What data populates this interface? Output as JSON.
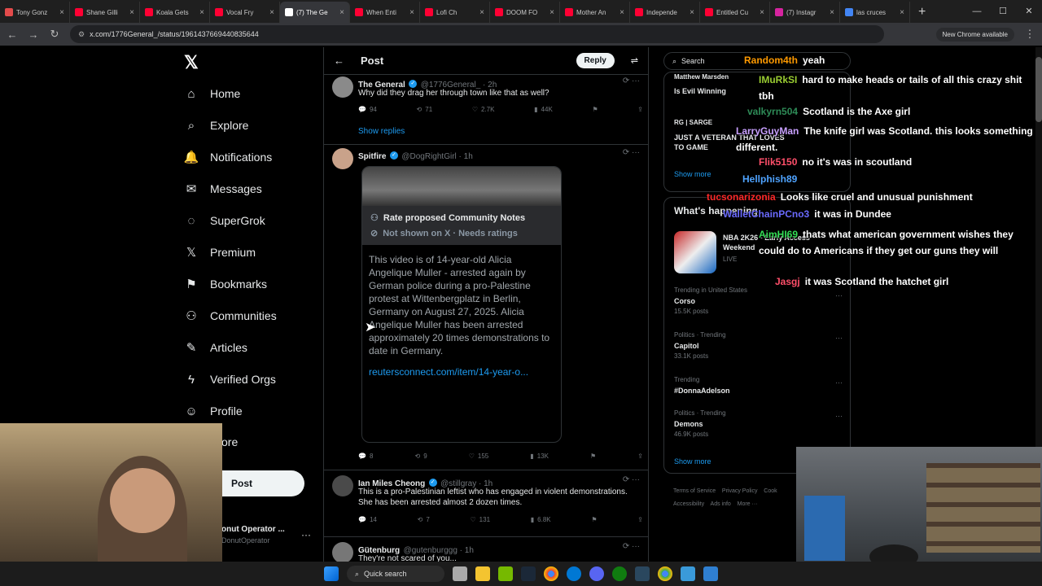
{
  "browser": {
    "tabs": [
      {
        "title": "Tony Gonz",
        "color": "#e34b4b"
      },
      {
        "title": "Shane Gilli",
        "color": "#ff0033"
      },
      {
        "title": "Koala Gets",
        "color": "#ff0033"
      },
      {
        "title": "Vocal Fry",
        "color": "#ff0033"
      },
      {
        "title": "(7) The Ge",
        "color": "#ffffff"
      },
      {
        "title": "When Enti",
        "color": "#ff0033"
      },
      {
        "title": "Lofi Ch",
        "color": "#ff0033"
      },
      {
        "title": "DOOM FO",
        "color": "#ff0033"
      },
      {
        "title": "Mother An",
        "color": "#ff0033"
      },
      {
        "title": "Independe",
        "color": "#ff0033"
      },
      {
        "title": "Entitled Cu",
        "color": "#ff0033"
      },
      {
        "title": "(7) Instagr",
        "color": "#d6249f"
      },
      {
        "title": "las cruces",
        "color": "#4285f4"
      }
    ],
    "active_tab_index": 4,
    "url": "x.com/1776General_/status/1961437669440835644",
    "chrome_available": "New Chrome available"
  },
  "nav": {
    "items": [
      {
        "label": "Home",
        "icon": "home-icon",
        "glyph": "⌂"
      },
      {
        "label": "Explore",
        "icon": "search-icon",
        "glyph": "⌕"
      },
      {
        "label": "Notifications",
        "icon": "bell-icon",
        "glyph": "🔔"
      },
      {
        "label": "Messages",
        "icon": "mail-icon",
        "glyph": "✉"
      },
      {
        "label": "SuperGrok",
        "icon": "grok-icon",
        "glyph": "◌"
      },
      {
        "label": "Premium",
        "icon": "x-icon",
        "glyph": "𝕏"
      },
      {
        "label": "Bookmarks",
        "icon": "bookmark-icon",
        "glyph": "⚑"
      },
      {
        "label": "Communities",
        "icon": "communities-icon",
        "glyph": "⚇"
      },
      {
        "label": "Articles",
        "icon": "article-icon",
        "glyph": "✎"
      },
      {
        "label": "Verified Orgs",
        "icon": "lightning-icon",
        "glyph": "ϟ"
      },
      {
        "label": "Profile",
        "icon": "person-icon",
        "glyph": "☺"
      },
      {
        "label": "ore",
        "icon": "more-icon",
        "glyph": ""
      }
    ],
    "post_button": "Post",
    "account_name": "onut Operator ...",
    "account_handle": "DonutOperator"
  },
  "center": {
    "header_title": "Post",
    "reply_button": "Reply",
    "tweets": [
      {
        "name": "The General",
        "handle": "@1776General_ · 2h",
        "text": "Why did they drag her through town like that as well?",
        "replies": "94",
        "reposts": "71",
        "likes": "2.7K",
        "views": "44K",
        "show_replies": "Show replies"
      },
      {
        "name": "Spitfire",
        "handle": "@DogRightGirl · 1h",
        "cn_title": "Rate proposed Community Notes",
        "cn_sub": "Not shown on X · Needs ratings",
        "cn_text": "This video is of 14-year-old Alicia Angelique Muller - arrested again by German police during a pro-Palestine protest at Wittenbergplatz in Berlin, Germany on August 27, 2025. Alicia Angelique Muller has been arrested approximately 20 times demonstrations to date in Germany.",
        "cn_link": "reutersconnect.com/item/14-year-o...",
        "replies": "8",
        "reposts": "9",
        "likes": "155",
        "views": "13K"
      },
      {
        "name": "Ian Miles Cheong",
        "handle": "@stillgray · 1h",
        "text": "This is a pro-Palestinian leftist who has engaged in violent demonstrations. She has been arrested almost 2 dozen times.",
        "replies": "14",
        "reposts": "7",
        "likes": "131",
        "views": "6.8K"
      },
      {
        "name": "Gütenburg",
        "handle": "@gutenburggg · 1h",
        "text": "They're not scared of you..."
      }
    ]
  },
  "right": {
    "search_placeholder": "Search",
    "who": [
      {
        "name": "Matthew Marsden",
        "sub": "Is Evil Winning"
      },
      {
        "name": "RG | SARGE",
        "sub": "JUST A VETERAN THAT LOVES TO GAME"
      }
    ],
    "show_more": "Show more",
    "happening_title": "What's happening",
    "event": {
      "title": "NBA 2K26 - Early Access Weekend",
      "sub": "LIVE"
    },
    "trends": [
      {
        "context": "Trending in United States",
        "name": "Corso",
        "posts": "15.5K posts"
      },
      {
        "context": "Politics · Trending",
        "name": "Capitol",
        "posts": "33.1K posts"
      },
      {
        "context": "Trending",
        "name": "#DonnaAdelson",
        "posts": ""
      },
      {
        "context": "Politics · Trending",
        "name": "Demons",
        "posts": "46.9K posts"
      }
    ],
    "footer": [
      "Terms of Service",
      "Privacy Policy",
      "Cook",
      "Accessibility",
      "Ads info",
      "More ···"
    ]
  },
  "chat": [
    {
      "user": "Random4th",
      "msg": "yeah",
      "color": "#ff9a00"
    },
    {
      "user": "IMuRkSI",
      "msg": "hard to make heads or tails of all this crazy shit tbh",
      "color": "#9acd32"
    },
    {
      "user": "valkyrn504",
      "msg": "Scotland is the Axe girl",
      "color": "#2e8b57"
    },
    {
      "user": "LarryGuyMan",
      "msg": "The knife girl was Scotland. this looks something different.",
      "color": "#c8a0ff"
    },
    {
      "user": "Flik5150",
      "msg": "no it's was in scoutland",
      "color": "#ff4f6a"
    },
    {
      "user": "Hellphish89",
      "msg": "",
      "color": "#4fa3ff"
    },
    {
      "user": "tucsonarizonia",
      "msg": "Looks like cruel and unusual punishment",
      "color": "#ff2a2a"
    },
    {
      "user": "WalletChainPCno3",
      "msg": "it was in Dundee",
      "color": "#6a6aff"
    },
    {
      "user": "AimHI69",
      "msg": "thats what american government wishes they could do to Americans if they get our guns they will",
      "color": "#33dd55"
    },
    {
      "user": "Jasgj",
      "msg": "it was Scotland the hatchet girl",
      "color": "#ff4f6a"
    }
  ],
  "taskbar": {
    "search": "Quick search"
  }
}
